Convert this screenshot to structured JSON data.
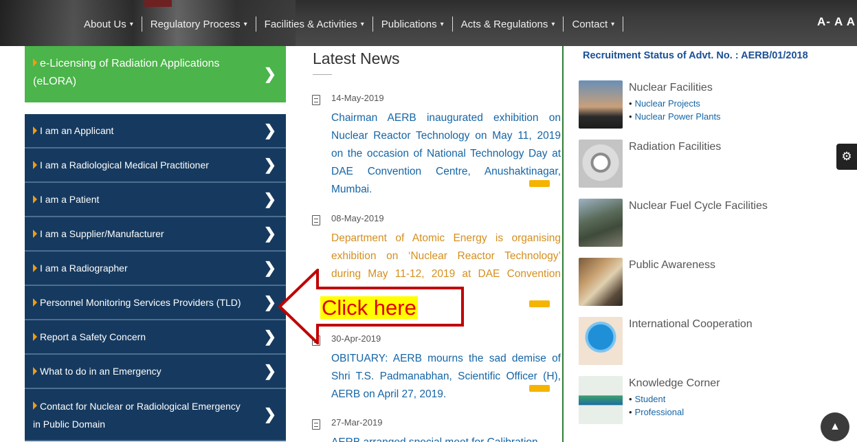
{
  "header": {
    "nav": [
      {
        "label": "About Us",
        "caret": "▾"
      },
      {
        "label": "Regulatory Process",
        "caret": "▾"
      },
      {
        "label": "Facilities & Activities",
        "caret": "▾"
      },
      {
        "label": "Publications",
        "caret": "▾"
      },
      {
        "label": "Acts & Regulations",
        "caret": "▾"
      },
      {
        "label": "Contact",
        "caret": "▾"
      }
    ],
    "font_size_controls": "A- A A"
  },
  "sidebar": {
    "elora_label": "e-Licensing of Radiation Applications (eLORA)",
    "items": [
      {
        "label": "I am an Applicant"
      },
      {
        "label": "I am a Radiological Medical Practitioner"
      },
      {
        "label": "I am a Patient"
      },
      {
        "label": "I am a Supplier/Manufacturer"
      },
      {
        "label": "I am a Radiographer"
      },
      {
        "label": "Personnel Monitoring Services Providers (TLD)"
      },
      {
        "label": "Report a Safety Concern"
      },
      {
        "label": "What to do in an Emergency"
      },
      {
        "label": "Contact for Nuclear or Radiological Emergency in Public Domain"
      }
    ],
    "chevron": "❯"
  },
  "news": {
    "title": "Latest News",
    "items": [
      {
        "date": "14-May-2019",
        "text": "Chairman AERB inaugurated exhibition on Nuclear Reactor Technology on May 11, 2019 on the occasion of National Technology Day at DAE Convention Centre, Anushaktinagar, Mumbai."
      },
      {
        "date": "08-May-2019",
        "text": "Department of Atomic Energy is organising exhibition on ‘Nuclear Reactor Technology’ during May 11-12, 2019 at DAE Convention Centre, Anushaktinagar,"
      },
      {
        "date": "30-Apr-2019",
        "text": "OBITUARY: AERB mourns the sad demise of Shri T.S. Padmanabhan, Scientific Officer (H), AERB on April 27, 2019."
      },
      {
        "date": "27-Mar-2019",
        "text": "AERB arranged special meet for Calibration"
      }
    ]
  },
  "facilities": {
    "recruitment_title": "Recruitment Status of Advt. No. : AERB/01/2018",
    "items": [
      {
        "name": "Nuclear Facilities",
        "subs": [
          "Nuclear Projects",
          "Nuclear Power Plants"
        ]
      },
      {
        "name": "Radiation Facilities",
        "subs": []
      },
      {
        "name": "Nuclear Fuel Cycle Facilities",
        "subs": []
      },
      {
        "name": "Public Awareness",
        "subs": []
      },
      {
        "name": "International Cooperation",
        "subs": []
      },
      {
        "name": "Knowledge Corner",
        "subs": [
          "Student",
          "Professional"
        ]
      }
    ]
  },
  "annotation": {
    "label": "Click here"
  },
  "icons": {
    "gear": "⚙",
    "scroll_top": "▲"
  },
  "colors": {
    "green": "#4bb44a",
    "navy": "#163a5f",
    "link_blue": "#1565a6",
    "orange": "#d58f1e",
    "annotation_red": "#c00000"
  }
}
